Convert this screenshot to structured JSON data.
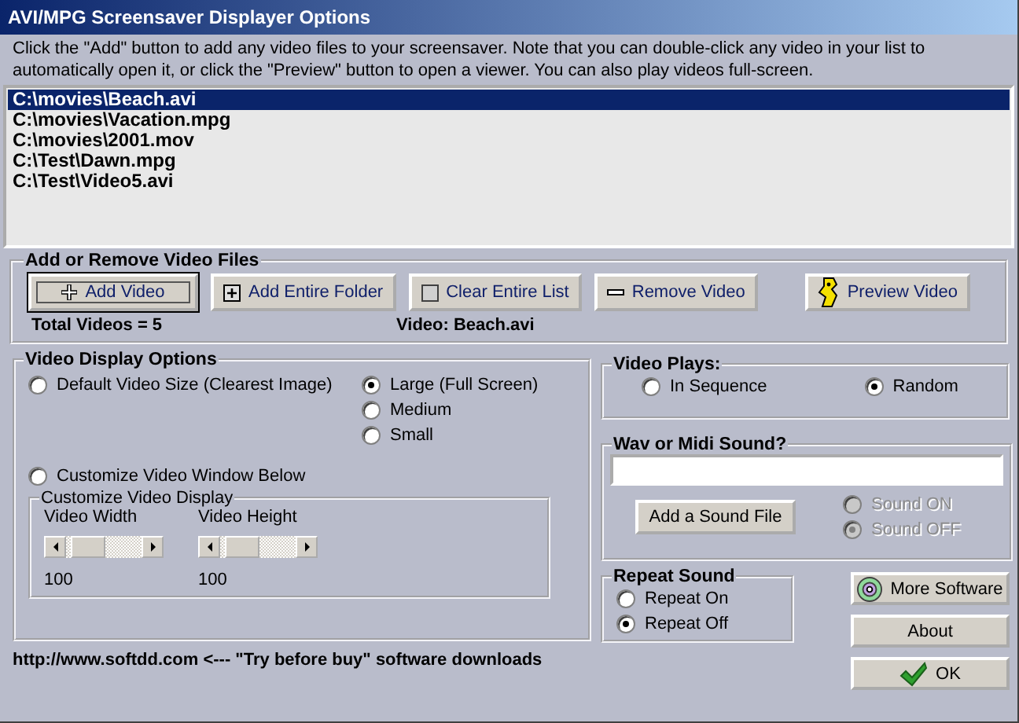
{
  "window": {
    "title": "AVI/MPG Screensaver Displayer Options"
  },
  "instructions": "Click the \"Add\" button to add any video files to your screensaver. Note that you can double-click any video in your list to automatically open it, or click the \"Preview\" button to open a viewer. You can also play videos full-screen.",
  "video_list": [
    {
      "path": "C:\\movies\\Beach.avi",
      "selected": true
    },
    {
      "path": "C:\\movies\\Vacation.mpg",
      "selected": false
    },
    {
      "path": "C:\\movies\\2001.mov",
      "selected": false
    },
    {
      "path": "C:\\Test\\Dawn.mpg",
      "selected": false
    },
    {
      "path": "C:\\Test\\Video5.avi",
      "selected": false
    }
  ],
  "files_group": {
    "title": "Add or Remove Video Files",
    "buttons": [
      {
        "label": "Add Video",
        "kind": "plus",
        "focused": true
      },
      {
        "label": "Add Entire Folder",
        "kind": "plus-box",
        "focused": false
      },
      {
        "label": "Clear Entire List",
        "kind": "square",
        "focused": false
      },
      {
        "label": "Remove Video",
        "kind": "minus",
        "focused": false
      },
      {
        "label": "Preview Video",
        "kind": "figure",
        "focused": false
      }
    ],
    "total": "Total Videos = 5",
    "current": "Video: Beach.avi"
  },
  "display_options": {
    "title": "Video Display Options",
    "modes": [
      {
        "label": "Default Video Size (Clearest Image)",
        "selected": false
      },
      {
        "label": "Customize Video Window Below",
        "selected": false
      }
    ],
    "sizes": [
      {
        "label": "Large (Full Screen)",
        "selected": true
      },
      {
        "label": "Medium",
        "selected": false
      },
      {
        "label": "Small",
        "selected": false
      }
    ],
    "custom_group": {
      "title": "Customize Video Display",
      "sliders": [
        {
          "label": "Video Width",
          "level": 0.1,
          "reading": "100"
        },
        {
          "label": "Video Height",
          "level": 0.1,
          "reading": "100"
        }
      ]
    }
  },
  "video_plays": {
    "title": "Video Plays:",
    "options": [
      {
        "label": "In Sequence",
        "selected": false
      },
      {
        "label": "Random",
        "selected": true
      }
    ]
  },
  "sound": {
    "title": "Wav or Midi Sound?",
    "button": "Add a Sound File",
    "options": [
      {
        "label": "Sound ON",
        "selected": false,
        "disabled": true
      },
      {
        "label": "Sound OFF",
        "selected": true,
        "disabled": true
      }
    ]
  },
  "repeat": {
    "title": "Repeat Sound",
    "options": [
      {
        "label": "Repeat On",
        "selected": false
      },
      {
        "label": "Repeat Off",
        "selected": true
      }
    ]
  },
  "buttons": [
    {
      "label": "More Software",
      "kind": "disc"
    },
    {
      "label": "About",
      "kind": "plain"
    },
    {
      "label": "OK",
      "kind": "check"
    }
  ],
  "footer": "http://www.softdd.com <--- \"Try before buy\" software downloads"
}
